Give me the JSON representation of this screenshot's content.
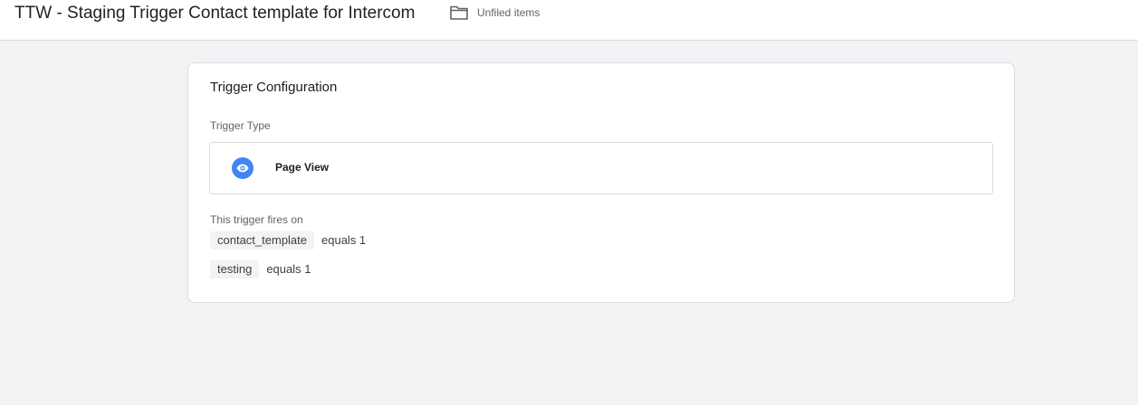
{
  "header": {
    "title": "TTW - Staging Trigger Contact template for Intercom",
    "folder_icon": "folder-outline-icon",
    "folder_label": "Unfiled items"
  },
  "card": {
    "title": "Trigger Configuration",
    "trigger_type_label": "Trigger Type",
    "trigger_type": {
      "icon": "eye-icon",
      "icon_color": "#4285f4",
      "name": "Page View"
    },
    "fires_on_label": "This trigger fires on",
    "conditions": [
      {
        "variable": "contact_template",
        "operator": "equals",
        "value": "1",
        "rest": "equals 1"
      },
      {
        "variable": "testing",
        "operator": "equals",
        "value": "1",
        "rest": "equals 1"
      }
    ]
  }
}
